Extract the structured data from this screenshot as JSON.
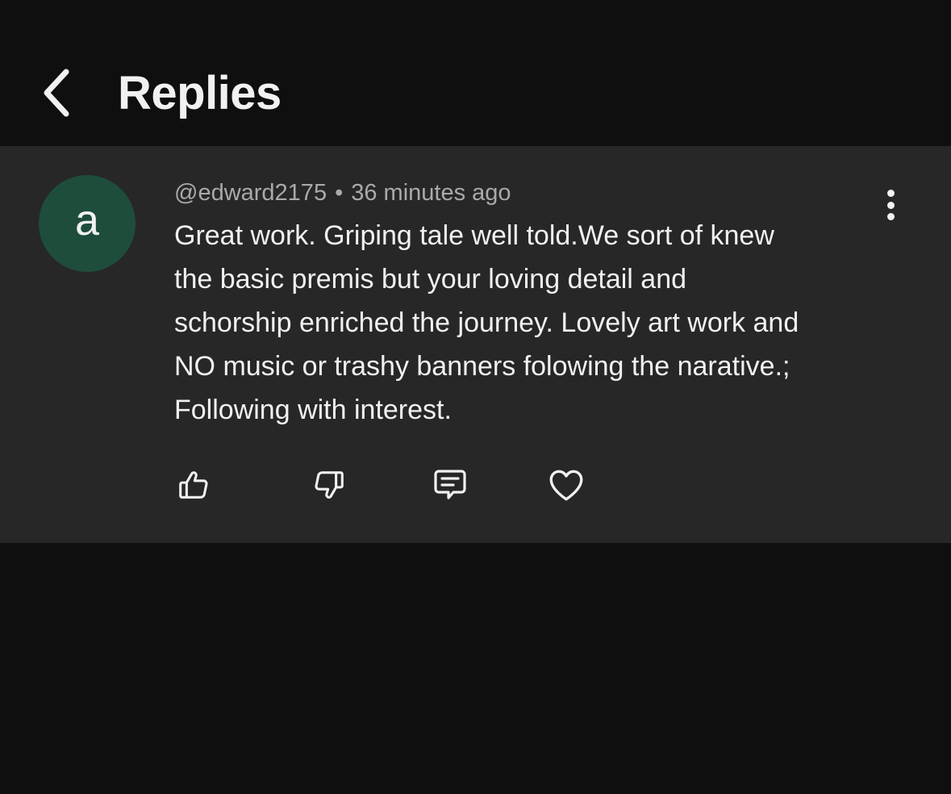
{
  "header": {
    "title": "Replies",
    "back_icon": "chevron-left-icon"
  },
  "comment": {
    "avatar_letter": "a",
    "avatar_color": "#1e4d3c",
    "author": "@edward2175",
    "separator": "•",
    "time": "36 minutes ago",
    "lines": [
      "Great work. Griping tale well told.We sort of knew",
      "the basic premis but your loving detail and",
      "schorship enriched the journey. Lovely art work and",
      "NO music or trashy banners folowing the narative.;",
      "Following with interest."
    ],
    "more_icon": "more-vertical-icon",
    "actions": {
      "like_icon": "thumbs-up-icon",
      "dislike_icon": "thumbs-down-icon",
      "reply_icon": "comment-icon",
      "heart_icon": "heart-icon"
    }
  },
  "colors": {
    "background": "#0f0f0f",
    "card": "#272727",
    "text": "#f1f1f1",
    "secondary_text": "#aaaaaa"
  }
}
